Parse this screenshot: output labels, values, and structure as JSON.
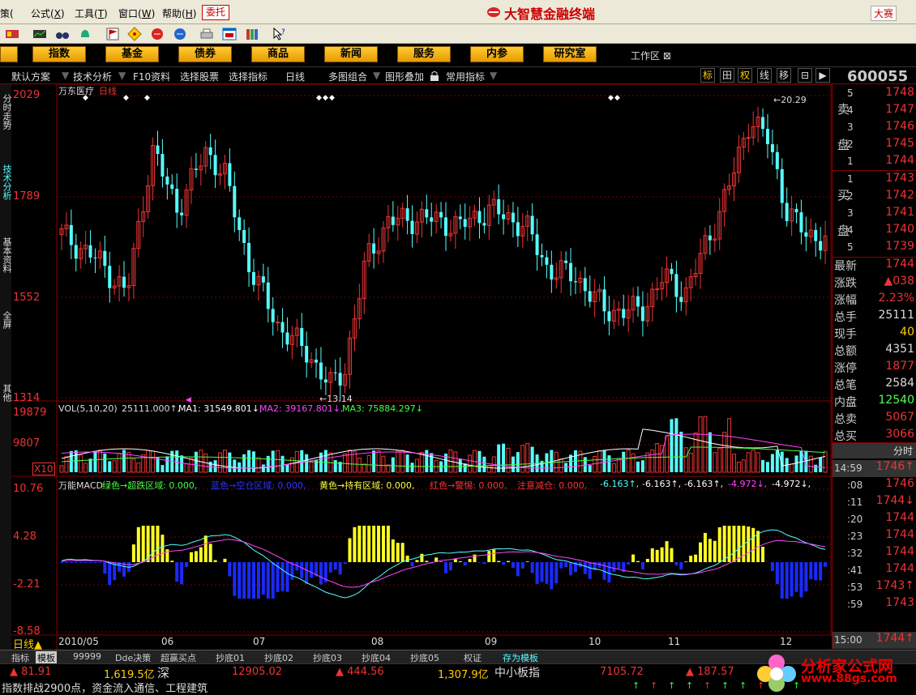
{
  "menu": {
    "items": [
      "策(",
      "公式(",
      "工具(",
      "窗口(",
      "帮助("
    ],
    "hotkeys": [
      "",
      "X",
      "T",
      "W",
      "H"
    ],
    "weituo": "委托",
    "app_title": "大智慧金融终端",
    "dasai": "大赛"
  },
  "nav": {
    "buttons": [
      "指数",
      "基金",
      "债券",
      "商品",
      "新闻",
      "服务",
      "内参",
      "研究室"
    ],
    "workspace": "工作区"
  },
  "funcbar": {
    "items": [
      "默认方案",
      "技术分析",
      "F10资料",
      "选择股票",
      "选择指标",
      "日线",
      "多图组合",
      "图形叠加",
      "常用指标"
    ],
    "toggles": [
      "标",
      "田",
      "权",
      "线",
      "移"
    ],
    "stock_code": "600055 万"
  },
  "sidetabs": [
    "分时走势",
    "技术分析",
    "基本资料",
    "全屏",
    "其他"
  ],
  "chart": {
    "title": "万东医疗",
    "period": "日线",
    "price_axis": [
      "2029",
      "1789",
      "1552",
      "1314"
    ],
    "high_note": "20.29",
    "low_note": "13.14",
    "vol_caption": {
      "name": "VOL(5,10,20)",
      "v": "25111.000↑,",
      "ma1": "MA1: 31549.801↓,",
      "ma2": "MA2: 39167.801↓,",
      "ma3": "MA3: 75884.297↓"
    },
    "vol_axis": [
      "19879",
      "9807",
      "X10"
    ],
    "macd_caption": {
      "name": "万能MACD",
      "green": "绿色→超跌区域: 0.000,",
      "blue": "蓝色→空仓区域: 0.000,",
      "yellow": "黄色→持有区域: 0.000,",
      "red": "红色→警惕: 0.000,",
      "warn": "注意减仓: 0.000,",
      "v1": "-6.163↑,",
      "v2": "-6.163↑,",
      "v3": "-6.163↑,",
      "v4": "-4.972↓,",
      "v5": "-4.972↓,"
    },
    "macd_axis": [
      "10.76",
      "4.28",
      "-2.21",
      "-8.58"
    ],
    "date_axis": [
      "2010/05",
      "06",
      "07",
      "08",
      "09",
      "10",
      "11",
      "12"
    ],
    "period_label": "日线"
  },
  "quote": {
    "sell_label": [
      "卖",
      "盘"
    ],
    "buy_label": [
      "买",
      "盘"
    ],
    "sell_levels": [
      "5",
      "4",
      "3",
      "2",
      "1"
    ],
    "sell_prices": [
      "1748",
      "1747",
      "1746",
      "1745",
      "1744"
    ],
    "buy_levels": [
      "1",
      "2",
      "3",
      "4",
      "5"
    ],
    "buy_prices": [
      "1743",
      "1742",
      "1741",
      "1740",
      "1739"
    ],
    "stats_labels": [
      "最新",
      "涨跌",
      "涨幅",
      "总手",
      "现手",
      "总额",
      "涨停",
      "总笔",
      "内盘",
      "总卖",
      "总买"
    ],
    "stats_values": [
      "1744",
      "▲038",
      "2.23%",
      "25111",
      "40",
      "4351",
      "1877",
      "2584",
      "12540",
      "5067",
      "3066"
    ],
    "fenshi": "分时",
    "ticks_time": [
      "14:59",
      ":08",
      ":11",
      ":20",
      ":23",
      ":32",
      ":41",
      ":53",
      ":59",
      "15:00"
    ],
    "ticks_price": [
      "1746",
      "1746",
      "1744",
      "1744",
      "1744",
      "1744",
      "1744",
      "1743",
      "1743",
      "1744"
    ],
    "ticks_arrow": [
      "↑",
      "",
      "↓",
      "",
      "",
      "",
      "",
      "↑",
      "",
      "↑"
    ]
  },
  "bottom_tabs": [
    "指标",
    "模板",
    "99999",
    "Dde决策",
    "超赢买点",
    "抄底01",
    "抄底02",
    "抄底03",
    "抄底04",
    "抄底05",
    "权证",
    "存为模板"
  ],
  "status": {
    "v1": "▲ 81.91",
    "v2": "1,619.5亿",
    "m1": "深",
    "v3": "12905.02",
    "v4": "▲ 444.56",
    "v5": "1,307.9亿",
    "m2": "中小板指",
    "v6": "7105.72",
    "v7": "▲ 187.57"
  },
  "ticker": "指数排战2900点，资金流入通信、工程建筑",
  "watermark": {
    "main": "分析家公式网",
    "url": "www.88gs.com"
  },
  "colors": {
    "up": "#ee3333",
    "down": "#55ffff",
    "macd_pos": "#ffff22",
    "macd_neg": "#1a2aff",
    "ma_white": "#ffffff",
    "ma_yellow": "#ffff44",
    "ma_magenta": "#ff44ff",
    "ma_green": "#44ff44",
    "grid": "#800000"
  }
}
